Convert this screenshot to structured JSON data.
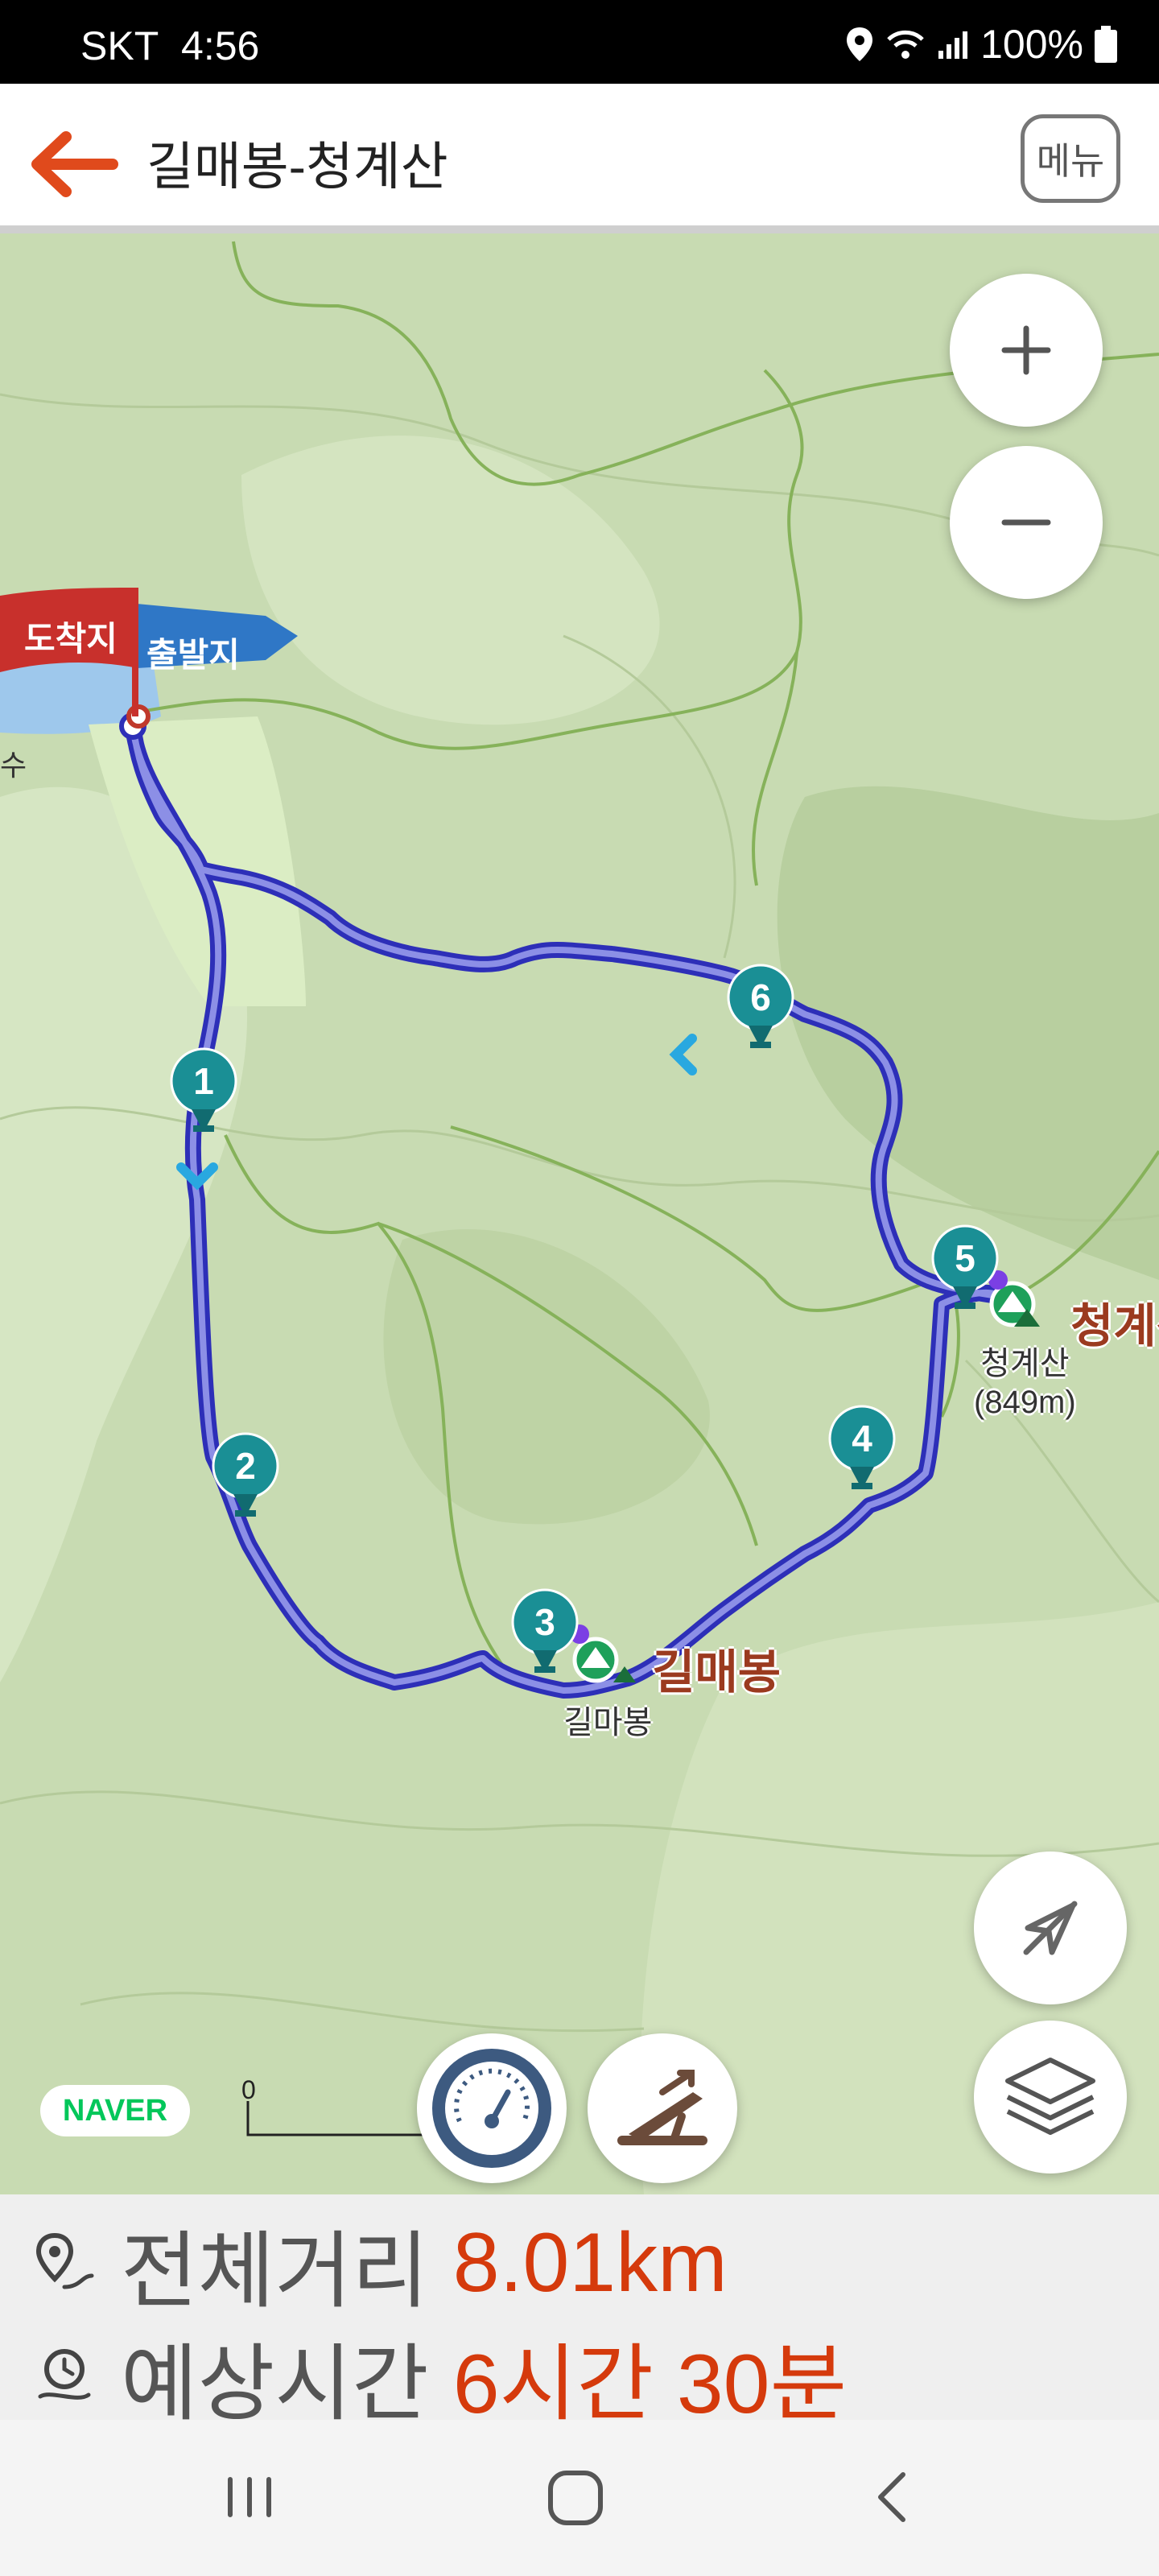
{
  "status_bar": {
    "carrier": "SKT",
    "time": "4:56",
    "battery": "100%"
  },
  "header": {
    "title": "길매봉-청계산",
    "menu_label": "메뉴"
  },
  "map": {
    "flag_arrival": "도착지",
    "flag_departure": "출발지",
    "waypoints": [
      "1",
      "2",
      "3",
      "4",
      "5",
      "6"
    ],
    "peaks": [
      {
        "name": "길매봉",
        "sub": "길마봉"
      },
      {
        "name": "청계산",
        "sub": "청계산",
        "elevation": "(849m)"
      }
    ],
    "attribution": "NAVER",
    "scale_zero": "0",
    "controls": {
      "zoom_in": "+",
      "zoom_out": "−"
    },
    "left_edge_text": "수"
  },
  "info": {
    "distance_label": "전체거리",
    "distance_value": "8.01km",
    "time_label": "예상시간",
    "time_value": "6시간 30분"
  },
  "colors": {
    "route": "#3a3fd1",
    "marker": "#1b9aa0",
    "accent": "#d53a0c"
  }
}
